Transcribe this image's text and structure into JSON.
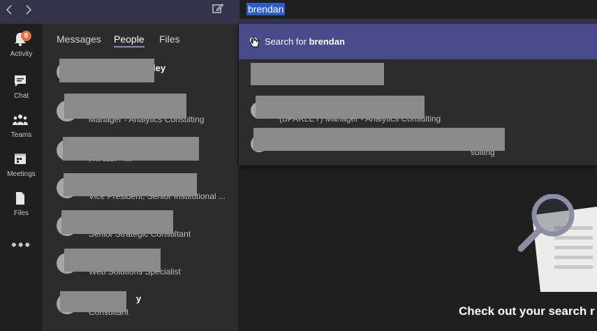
{
  "search": {
    "query": "brendan"
  },
  "rail": {
    "items": [
      {
        "label": "Activity",
        "icon": "bell-icon",
        "badge": "8"
      },
      {
        "label": "Chat",
        "icon": "chat-icon"
      },
      {
        "label": "Teams",
        "icon": "teams-icon"
      },
      {
        "label": "Meetings",
        "icon": "calendar-icon"
      },
      {
        "label": "Files",
        "icon": "file-icon"
      }
    ],
    "more": "•••"
  },
  "tabs": [
    "Messages",
    "People",
    "Files"
  ],
  "people": [
    {
      "name": "ley",
      "sub": ""
    },
    {
      "name": "",
      "sub": "Manager - Analytics Consulting"
    },
    {
      "name": "",
      "sub": ", ... ator - ..."
    },
    {
      "name": "",
      "sub": "Vice President, Senior Institutional ..."
    },
    {
      "name": "",
      "sub": "Senior Strategic Consultant"
    },
    {
      "name": "",
      "sub": "Web Solutions Specialist"
    },
    {
      "name": "y",
      "sub": "Consultant"
    }
  ],
  "dropdown": {
    "search_prefix": "Search for",
    "search_term": "brendan",
    "suggestions": [
      {
        "sub": ""
      },
      {
        "sub": "(BPARLEY) Manager - Analytics Consulting"
      },
      {
        "sub": "sulting"
      }
    ]
  },
  "empty_state": {
    "message": "Check out your search r"
  },
  "colors": {
    "topbar": "#33344a",
    "accent": "#494a8a",
    "badge": "#e4703f",
    "selection": "#2a5ccc"
  }
}
